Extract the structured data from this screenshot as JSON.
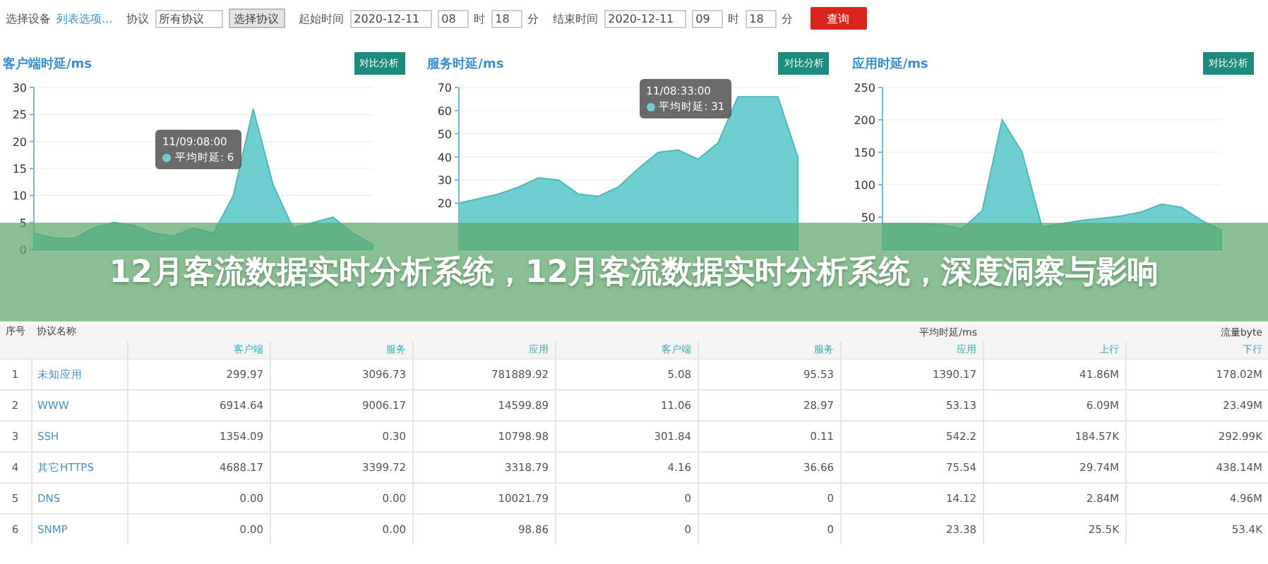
{
  "filter_bar": {
    "device_label": "选择设备",
    "device_link": "列表选项...",
    "protocol_label": "协议",
    "protocol_value": "所有协议",
    "protocol_button": "选择协议",
    "start": {
      "label": "起始时间",
      "date": "2020-12-11",
      "hour": "08",
      "hour_unit": "时",
      "minute": "18",
      "minute_unit": "分"
    },
    "end": {
      "label": "结束时间",
      "date": "2020-12-11",
      "hour": "09",
      "hour_unit": "时",
      "minute": "18",
      "minute_unit": "分"
    },
    "query_button": "查询"
  },
  "charts": [
    {
      "title": "客户端时延/ms",
      "button": "对比分析",
      "tooltip": {
        "time": "11/09:08:00",
        "label": "平均时延: 6"
      },
      "chart_data": {
        "type": "area",
        "grid": true,
        "ylim": [
          0,
          30
        ],
        "yticks": [
          0,
          5,
          10,
          15,
          20,
          25,
          30
        ],
        "values": [
          3,
          2.2,
          2,
          4,
          5,
          4.5,
          3,
          2.5,
          4,
          3,
          10,
          26,
          12,
          4,
          5,
          6,
          3,
          1
        ]
      }
    },
    {
      "title": "服务时延/ms",
      "button": "对比分析",
      "tooltip": {
        "time": "11/08:33:00",
        "label": "平均时延: 31"
      },
      "chart_data": {
        "type": "area",
        "grid": true,
        "ylim": [
          0,
          70
        ],
        "yticks": [
          20,
          30,
          40,
          50,
          60,
          70
        ],
        "values": [
          20,
          22,
          24,
          27,
          31,
          30,
          24,
          23,
          27,
          35,
          42,
          43,
          39,
          46,
          66,
          66,
          66,
          40
        ]
      }
    },
    {
      "title": "应用时延/ms",
      "button": "对比分析",
      "chart_data": {
        "type": "area",
        "grid": true,
        "ylim": [
          0,
          250
        ],
        "yticks": [
          50,
          100,
          150,
          200,
          250
        ],
        "values": [
          40,
          40,
          40,
          38,
          32,
          60,
          200,
          150,
          35,
          40,
          45,
          48,
          52,
          58,
          70,
          65,
          45,
          30
        ]
      }
    }
  ],
  "banner": {
    "title": "12月客流数据实时分析系统，12月客流数据实时分析系统，深度洞察与影响"
  },
  "table": {
    "header": [
      {
        "label": "序号"
      },
      {
        "label": "协议名称"
      }
    ],
    "groups": [
      {
        "columns": [
          "客户端",
          "服务",
          "应用"
        ]
      },
      {
        "label": "平均时延/ms",
        "columns": [
          "客户端",
          "服务",
          "应用"
        ]
      },
      {
        "label": "流量byte",
        "columns": [
          "上行",
          "下行"
        ]
      }
    ],
    "rows": [
      {
        "index": "1",
        "name": "未知应用",
        "cells": [
          "299.97",
          "3096.73",
          "781889.92",
          "5.08",
          "95.53",
          "1390.17",
          "41.86M",
          "178.02M"
        ]
      },
      {
        "index": "2",
        "name": "WWW",
        "cells": [
          "6914.64",
          "9006.17",
          "14599.89",
          "11.06",
          "28.97",
          "53.13",
          "6.09M",
          "23.49M"
        ]
      },
      {
        "index": "3",
        "name": "SSH",
        "cells": [
          "1354.09",
          "0.30",
          "10798.98",
          "301.84",
          "0.11",
          "542.2",
          "184.57K",
          "292.99K"
        ]
      },
      {
        "index": "4",
        "name": "其它HTTPS",
        "cells": [
          "4688.17",
          "3399.72",
          "3318.79",
          "4.16",
          "36.66",
          "75.54",
          "29.74M",
          "438.14M"
        ]
      },
      {
        "index": "5",
        "name": "DNS",
        "cells": [
          "0.00",
          "0.00",
          "10021.79",
          "0",
          "0",
          "14.12",
          "2.84M",
          "4.96M"
        ]
      },
      {
        "index": "6",
        "name": "SNMP",
        "cells": [
          "0.00",
          "0.00",
          "98.86",
          "0",
          "0",
          "23.38",
          "25.5K",
          "53.4K"
        ]
      }
    ]
  }
}
